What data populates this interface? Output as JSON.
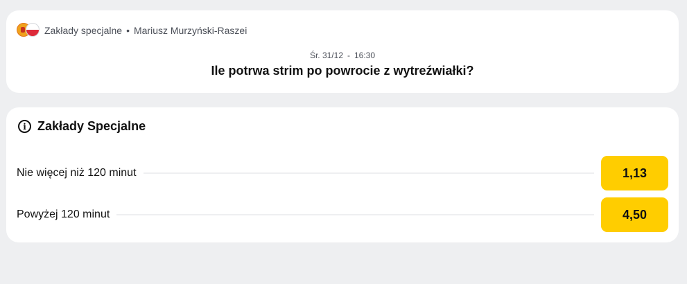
{
  "breadcrumb": {
    "category": "Zakłady specjalne",
    "separator": "•",
    "event_name": "Mariusz Murzyński-Raszei",
    "flags": [
      "spain-flag-icon",
      "poland-flag-icon"
    ]
  },
  "event": {
    "date": "Śr. 31/12",
    "dash": "-",
    "time": "16:30",
    "question": "Ile potrwa strim po powrocie z wytreźwiałki?"
  },
  "market": {
    "icon": "info-icon",
    "title": "Zakłady Specjalne",
    "outcomes": [
      {
        "label": "Nie więcej niż 120 minut",
        "odds": "1,13"
      },
      {
        "label": "Powyżej 120 minut",
        "odds": "4,50"
      }
    ]
  },
  "colors": {
    "background": "#eeeff1",
    "card": "#ffffff",
    "odds_button": "#ffcd00"
  }
}
